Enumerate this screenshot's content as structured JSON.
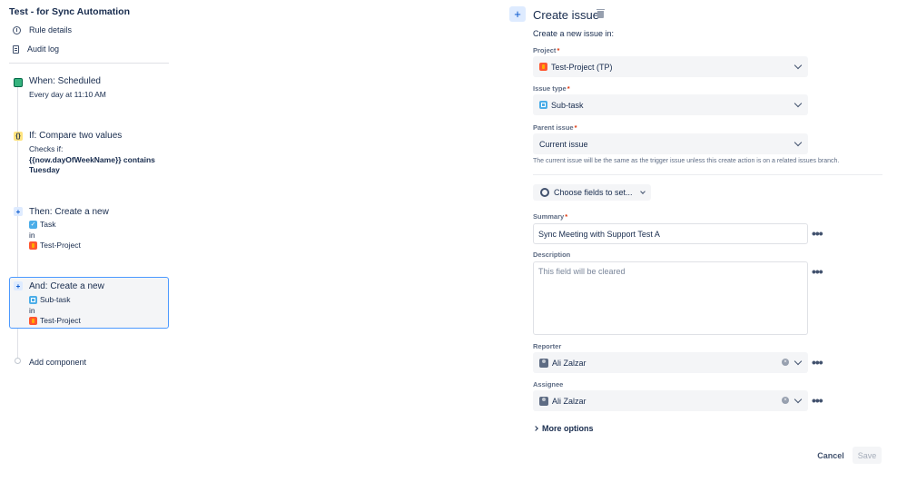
{
  "left": {
    "rule_title": "Test - for Sync Automation",
    "nav": [
      {
        "label": "Rule details",
        "icon": "info-icon"
      },
      {
        "label": "Audit log",
        "icon": "audit-log-icon"
      }
    ],
    "trigger": {
      "title": "When: Scheduled",
      "detail": "Every day at 11:10 AM"
    },
    "condition": {
      "title": "If: Compare two values",
      "line1": "Checks if:",
      "line2": "{{now.dayOfWeekName}} contains",
      "line3": "Tuesday"
    },
    "action1": {
      "title": "Then: Create a new",
      "type": "Task",
      "in": "in",
      "project": "Test-Project"
    },
    "action2": {
      "title": "And: Create a new",
      "type": "Sub-task",
      "in": "in",
      "project": "Test-Project"
    },
    "add_component": "Add component"
  },
  "right": {
    "title": "Create issue",
    "subheading": "Create a new issue in:",
    "project_label": "Project",
    "project_value": "Test-Project (TP)",
    "issue_type_label": "Issue type",
    "issue_type_value": "Sub-task",
    "parent_label": "Parent issue",
    "parent_value": "Current issue",
    "parent_helper": "The current issue will be the same as the trigger issue unless this create action is on a related issues branch.",
    "choose_fields": "Choose fields to set...",
    "summary_label": "Summary",
    "summary_value": "Sync Meeting with Support Test A",
    "description_label": "Description",
    "description_placeholder": "This field will be cleared",
    "reporter_label": "Reporter",
    "reporter_value": "Ali Zalzar",
    "assignee_label": "Assignee",
    "assignee_value": "Ali Zalzar",
    "more_options": "More options",
    "cancel": "Cancel",
    "save": "Save",
    "required_mark": "*",
    "plus": "+",
    "dots": "•••"
  }
}
